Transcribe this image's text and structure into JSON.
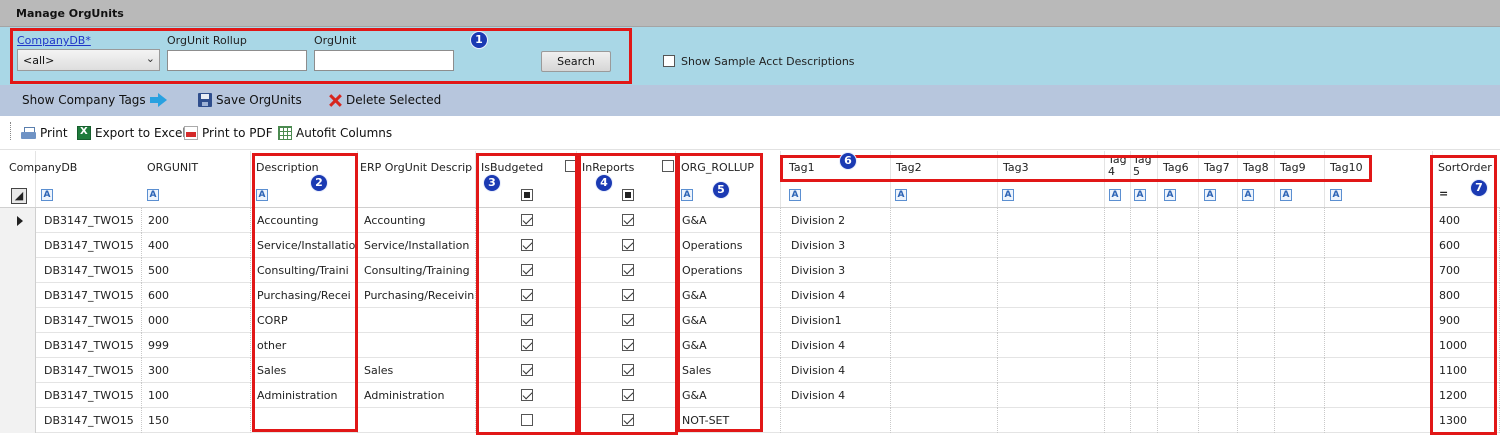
{
  "window": {
    "title": "Manage OrgUnits"
  },
  "filters": {
    "companydb_label": "CompanyDB*",
    "companydb_value": "<all>",
    "orgunit_rollup_label": "OrgUnit Rollup",
    "orgunit_rollup_value": "",
    "orgunit_label": "OrgUnit",
    "orgunit_value": "",
    "search_label": "Search",
    "show_sample_label": "Show Sample Acct Descriptions",
    "show_sample_checked": false
  },
  "actions": {
    "show_tags": "Show Company Tags",
    "save": "Save OrgUnits",
    "delete": "Delete Selected"
  },
  "toolbar": {
    "print": "Print",
    "export_excel": "Export to Excel",
    "print_pdf": "Print to PDF",
    "autofit": "Autofit Columns"
  },
  "grid": {
    "columns": {
      "companydb": "CompanyDB",
      "orgunit": "ORGUNIT",
      "description": "Description",
      "erp_desc": "ERP OrgUnit Descrip",
      "isbudgeted": "IsBudgeted",
      "inreports": "InReports",
      "org_rollup": "ORG_ROLLUP",
      "tag1": "Tag1",
      "tag2": "Tag2",
      "tag3": "Tag3",
      "tag4": "Tag 4",
      "tag5": "Tag 5",
      "tag6": "Tag6",
      "tag7": "Tag7",
      "tag8": "Tag8",
      "tag9": "Tag9",
      "tag10": "Tag10",
      "sortorder": "SortOrder"
    },
    "filter_glyph": "A",
    "sort_glyph": "=",
    "rows": [
      {
        "companydb": "DB3147_TWO15",
        "orgunit": "200",
        "description": "Accounting",
        "erp_desc": "Accounting",
        "isbudgeted": true,
        "inreports": true,
        "org_rollup": "G&A",
        "tag1": "Division 2",
        "sortorder": "400"
      },
      {
        "companydb": "DB3147_TWO15",
        "orgunit": "400",
        "description": "Service/Installatio",
        "erp_desc": "Service/Installation",
        "isbudgeted": true,
        "inreports": true,
        "org_rollup": "Operations",
        "tag1": "Division 3",
        "sortorder": "600"
      },
      {
        "companydb": "DB3147_TWO15",
        "orgunit": "500",
        "description": "Consulting/Traini",
        "erp_desc": "Consulting/Training",
        "isbudgeted": true,
        "inreports": true,
        "org_rollup": "Operations",
        "tag1": "Division 3",
        "sortorder": "700"
      },
      {
        "companydb": "DB3147_TWO15",
        "orgunit": "600",
        "description": "Purchasing/Recei",
        "erp_desc": "Purchasing/Receivin",
        "isbudgeted": true,
        "inreports": true,
        "org_rollup": "G&A",
        "tag1": "Division 4",
        "sortorder": "800"
      },
      {
        "companydb": "DB3147_TWO15",
        "orgunit": "000",
        "description": "CORP",
        "erp_desc": "",
        "isbudgeted": true,
        "inreports": true,
        "org_rollup": "G&A",
        "tag1": "Division1",
        "sortorder": "900"
      },
      {
        "companydb": "DB3147_TWO15",
        "orgunit": "999",
        "description": "other",
        "erp_desc": "",
        "isbudgeted": true,
        "inreports": true,
        "org_rollup": "G&A",
        "tag1": "Division 4",
        "sortorder": "1000"
      },
      {
        "companydb": "DB3147_TWO15",
        "orgunit": "300",
        "description": "Sales",
        "erp_desc": "Sales",
        "isbudgeted": true,
        "inreports": true,
        "org_rollup": "Sales",
        "tag1": "Division 4",
        "sortorder": "1100"
      },
      {
        "companydb": "DB3147_TWO15",
        "orgunit": "100",
        "description": "Administration",
        "erp_desc": "Administration",
        "isbudgeted": true,
        "inreports": true,
        "org_rollup": "G&A",
        "tag1": "Division 4",
        "sortorder": "1200"
      },
      {
        "companydb": "DB3147_TWO15",
        "orgunit": "150",
        "description": "",
        "erp_desc": "",
        "isbudgeted": false,
        "inreports": true,
        "org_rollup": "NOT-SET",
        "tag1": "",
        "sortorder": "1300"
      }
    ]
  },
  "callouts": [
    "1",
    "2",
    "3",
    "4",
    "5",
    "6",
    "7"
  ],
  "colors": {
    "filter_bg": "#a9d7e6",
    "action_bg": "#b7c6dd",
    "title_bg": "#b9b9b9",
    "callout_box": "#e11717",
    "callout_badge": "#1b3ab3"
  }
}
